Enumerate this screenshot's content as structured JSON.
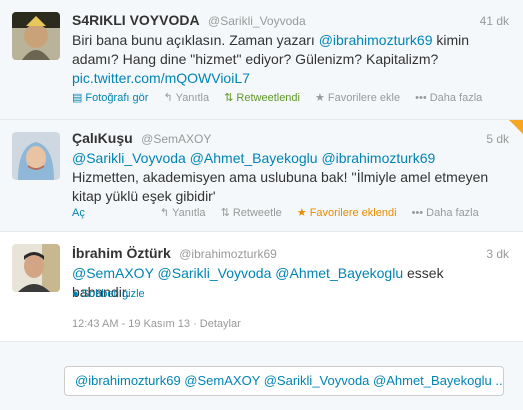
{
  "tweets": [
    {
      "fullname": "S4RIKLI VOYVODA",
      "username": "@Sarikli_Voyvoda",
      "time": "41 dk",
      "text": {
        "p1": "Biri bana bunu açıklasın. Zaman yazarı ",
        "m1": "@ibrahimozturk69",
        "p2": " kimin adamı? Hang dine \"hizmet\" ediyor? Gülenizm? Kapitalizm? ",
        "link": "pic.twitter.com/mQOWVioiL7"
      },
      "actions": {
        "media": "Fotoğrafı gör",
        "reply": "Yanıtla",
        "retweet": "Retweetlendi",
        "favorite": "Favorilere ekle",
        "more": "Daha fazla"
      }
    },
    {
      "fullname": "ÇalıKuşu",
      "username": "@SemAXOY",
      "time": "5 dk",
      "text": {
        "m1": "@Sarikli_Voyvoda",
        "m2": "@Ahmet_Bayekoglu",
        "m3": "@ibrahimozturk69",
        "p1": " Hizmetten, akademisyen ama uslubuna bak! ''İlmiyle amel etmeyen kitap yüklü eşek gibidir'"
      },
      "actions": {
        "open": "Aç",
        "reply": "Yanıtla",
        "retweet": "Retweetle",
        "favorite": "Favorilere eklendi",
        "more": "Daha fazla"
      }
    },
    {
      "fullname": "İbrahim Öztürk",
      "username": "@ibrahimozturk69",
      "time": "3 dk",
      "text": {
        "m1": "@SemAXOY",
        "m2": "@Sarikli_Voyvoda",
        "m3": "@Ahmet_Bayekoglu",
        "p1": " essek babandir."
      },
      "actions": {
        "conversation": "Sohbeti gizle"
      },
      "meta": "12:43 AM - 19 Kasım 13 · Detaylar"
    }
  ],
  "reply_box": {
    "value": "@ibrahimozturk69 @SemAXOY @Sarikli_Voyvoda @Ahmet_Bayekoglu ..."
  },
  "icons": {
    "reply": "reply-arrow-icon",
    "retweet": "retweet-icon",
    "favorite": "star-icon",
    "more": "more-dots-icon",
    "media": "photo-icon",
    "conversation": "speech-bubble-icon"
  },
  "colors": {
    "link": "#0084b4",
    "retweeted": "#609928",
    "favorited": "#e88c00",
    "muted": "#999999"
  }
}
